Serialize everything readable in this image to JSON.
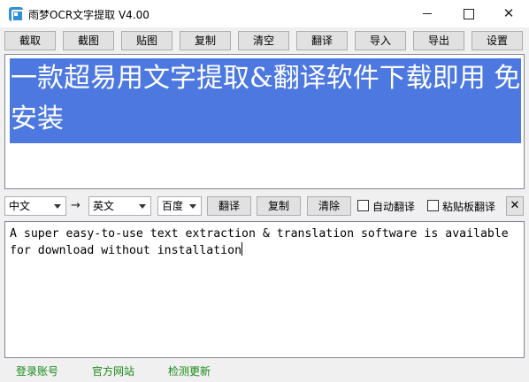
{
  "window": {
    "title": "雨梦OCR文字提取 V4.00",
    "minimize": "",
    "maximize": "",
    "close": "✕"
  },
  "toolbar": {
    "buttons": [
      "截取",
      "截图",
      "贴图",
      "复制",
      "清空",
      "翻译",
      "导入",
      "导出",
      "设置"
    ]
  },
  "source": {
    "text": "一款超易用文字提取&翻译软件下载即用 免安装",
    "highlight_color": "#4c78df"
  },
  "translate_bar": {
    "source_lang": "中文",
    "arrow": "→",
    "target_lang": "英文",
    "engine": "百度",
    "translate_label": "翻译",
    "copy_label": "复制",
    "clear_label": "清除",
    "auto_translate_label": "自动翻译",
    "auto_translate_checked": false,
    "clipboard_translate_label": "粘贴板翻译",
    "clipboard_translate_checked": false,
    "close_label": "✕"
  },
  "result": {
    "text": "A super easy-to-use text extraction & translation software is available for download without installation"
  },
  "status_links": {
    "login": "登录账号",
    "website": "官方网站",
    "update": "检测更新",
    "color": "#1a8a1a"
  }
}
